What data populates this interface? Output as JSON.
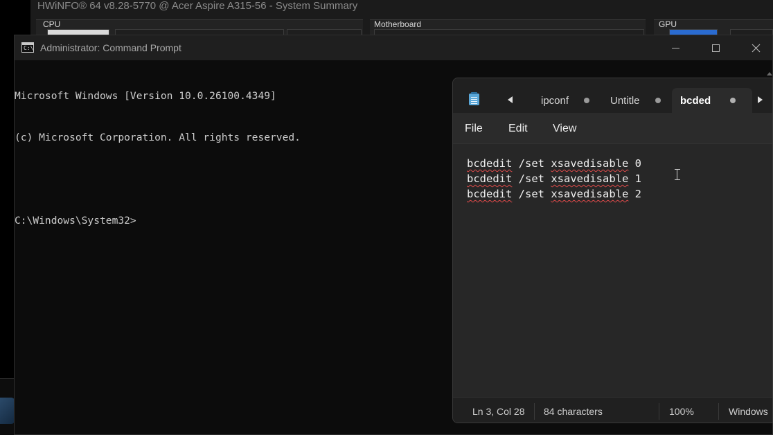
{
  "hwinfo": {
    "title": "HWiNFO® 64 v8.28-5770 @ Acer Aspire A315-56 - System Summary",
    "sections": {
      "cpu": "CPU",
      "motherboard": "Motherboard",
      "gpu": "GPU"
    }
  },
  "cmd": {
    "title": "Administrator: Command Prompt",
    "icon_text": "C:\\",
    "lines": [
      "Microsoft Windows [Version 10.0.26100.4349]",
      "(c) Microsoft Corporation. All rights reserved.",
      "",
      "C:\\Windows\\System32>"
    ]
  },
  "notepad": {
    "tabs": [
      {
        "label": "ipconf",
        "active": false
      },
      {
        "label": "Untitle",
        "active": false
      },
      {
        "label": "bcded",
        "active": true
      }
    ],
    "menu": {
      "file": "File",
      "edit": "Edit",
      "view": "View"
    },
    "editor": {
      "lines": [
        {
          "cmd": "bcdedit",
          "arg1": "/set",
          "arg2": "xsavedisable",
          "val": "0"
        },
        {
          "cmd": "bcdedit",
          "arg1": "/set",
          "arg2": "xsavedisable",
          "val": "1"
        },
        {
          "cmd": "bcdedit",
          "arg1": "/set",
          "arg2": "xsavedisable",
          "val": "2"
        }
      ]
    },
    "status": {
      "position": "Ln 3, Col 28",
      "characters": "84 characters",
      "zoom": "100%",
      "encoding": "Windows"
    }
  },
  "icons": {
    "cmd": "command-prompt-icon",
    "notepad": "notepad-icon",
    "minimize": "minimize-icon",
    "maximize": "maximize-icon",
    "close": "close-icon",
    "tab_prev": "chevron-left-icon",
    "tab_next": "chevron-right-icon",
    "text_cursor": "ibeam-cursor-icon"
  }
}
